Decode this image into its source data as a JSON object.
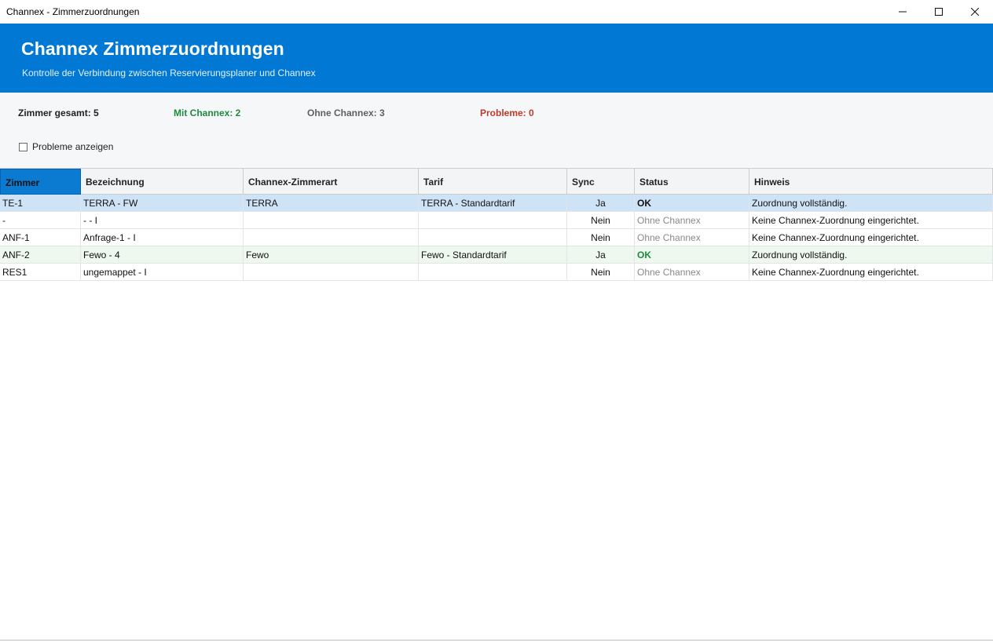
{
  "window": {
    "title": "Channex - Zimmerzuordnungen"
  },
  "header": {
    "title": "Channex Zimmerzuordnungen",
    "subtitle": "Kontrolle der Verbindung zwischen Reservierungsplaner und Channex",
    "background_color": "#0078d4"
  },
  "summary": {
    "total": "Zimmer gesamt: 5",
    "with_channex": "Mit Channex: 2",
    "without_channex": "Ohne Channex: 3",
    "problems": "Probleme: 0",
    "show_problems_label": "Probleme anzeigen",
    "show_problems_checked": false
  },
  "table": {
    "columns": [
      "Zimmer",
      "Bezeichnung",
      "Channex-Zimmerart",
      "Tarif",
      "Sync",
      "Status",
      "Hinweis"
    ],
    "rows": [
      {
        "zimmer": "TE-1",
        "bezeichnung": "TERRA - FW",
        "zimmerart": "TERRA",
        "tarif": "TERRA - Standardtarif",
        "sync": "Ja",
        "status": "OK",
        "hinweis": "Zuordnung vollständig."
      },
      {
        "zimmer": "-",
        "bezeichnung": "- - I",
        "zimmerart": "",
        "tarif": "",
        "sync": "Nein",
        "status": "Ohne Channex",
        "hinweis": "Keine Channex-Zuordnung eingerichtet."
      },
      {
        "zimmer": "ANF-1",
        "bezeichnung": "Anfrage-1 - I",
        "zimmerart": "",
        "tarif": "",
        "sync": "Nein",
        "status": "Ohne Channex",
        "hinweis": "Keine Channex-Zuordnung eingerichtet."
      },
      {
        "zimmer": "ANF-2",
        "bezeichnung": "Fewo - 4",
        "zimmerart": "Fewo",
        "tarif": "Fewo - Standardtarif",
        "sync": "Ja",
        "status": "OK",
        "hinweis": "Zuordnung vollständig."
      },
      {
        "zimmer": "RES1",
        "bezeichnung": "ungemappet - I",
        "zimmerart": "",
        "tarif": "",
        "sync": "Nein",
        "status": "Ohne Channex",
        "hinweis": "Keine Channex-Zuordnung eingerichtet."
      }
    ]
  },
  "colors": {
    "accent": "#0078d4",
    "ok_green": "#1e8a3e",
    "problem_red": "#c0392b",
    "muted_gray": "#8a8a8a"
  }
}
